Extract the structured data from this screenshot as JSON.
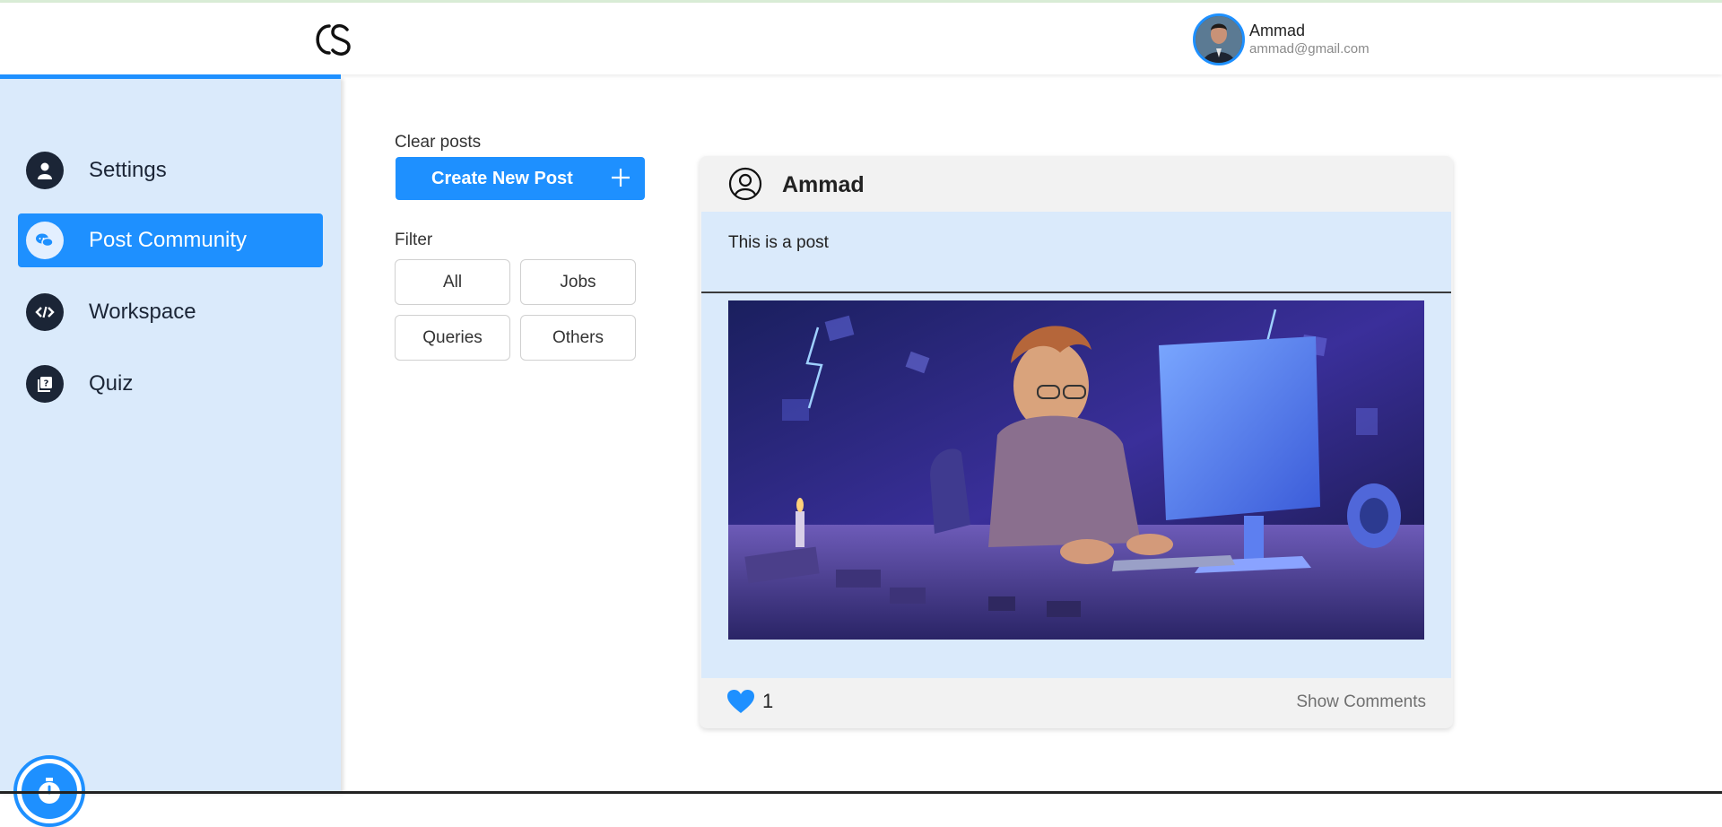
{
  "header": {
    "logo_icon": "cs-logo-icon",
    "user": {
      "name": "Ammad",
      "email": "ammad@gmail.com",
      "avatar_icon": "user-avatar"
    }
  },
  "sidebar": {
    "items": [
      {
        "label": "Settings",
        "icon": "user-icon",
        "active": false
      },
      {
        "label": "Post Community",
        "icon": "chat-icon",
        "active": true
      },
      {
        "label": "Workspace",
        "icon": "code-icon",
        "active": false
      },
      {
        "label": "Quiz",
        "icon": "quiz-icon",
        "active": false
      }
    ],
    "timer_icon": "stopwatch-icon"
  },
  "controls": {
    "clear_posts": "Clear posts",
    "create_post": "Create New Post",
    "filter_label": "Filter",
    "filters": [
      "All",
      "Jobs",
      "Queries",
      "Others"
    ]
  },
  "post": {
    "author": "Ammad",
    "text": "This is a post",
    "image_desc": "cartoon-developer-at-computer",
    "likes": "1",
    "show_comments": "Show Comments"
  },
  "colors": {
    "accent": "#1e90ff",
    "sidebar_bg": "#daeafb",
    "dark_icon": "#1b2536"
  }
}
